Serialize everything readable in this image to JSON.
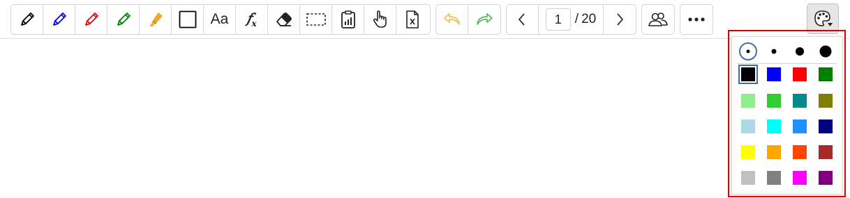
{
  "toolbar": {
    "tools": [
      {
        "name": "pencil-black",
        "icon": "pencil-icon",
        "color": "#000000"
      },
      {
        "name": "pencil-blue",
        "icon": "pencil-icon",
        "color": "#0000ee"
      },
      {
        "name": "pencil-red",
        "icon": "pencil-icon",
        "color": "#ee0000"
      },
      {
        "name": "pencil-green",
        "icon": "pencil-icon",
        "color": "#008000"
      },
      {
        "name": "highlighter",
        "icon": "highlighter-icon",
        "color": "#f5a623"
      },
      {
        "name": "rectangle",
        "icon": "rectangle-icon"
      },
      {
        "name": "text",
        "icon": "text-icon",
        "label": "Aa"
      },
      {
        "name": "formula",
        "icon": "formula-icon",
        "label": "fx"
      },
      {
        "name": "eraser",
        "icon": "eraser-icon"
      },
      {
        "name": "select",
        "icon": "dashed-select-icon"
      },
      {
        "name": "clipboard-chart",
        "icon": "clipboard-chart-icon"
      },
      {
        "name": "pointer",
        "icon": "hand-pointer-icon"
      },
      {
        "name": "clear-page",
        "icon": "clear-file-icon"
      }
    ],
    "history": {
      "undo_color": "#f0c050",
      "redo_color": "#5cb85c"
    },
    "pagination": {
      "current": "1",
      "separator": "/",
      "total": "20"
    }
  },
  "palette_panel": {
    "sizes": [
      {
        "name": "size-small",
        "selected": true
      },
      {
        "name": "size-medium",
        "selected": false
      },
      {
        "name": "size-large",
        "selected": false
      },
      {
        "name": "size-xlarge",
        "selected": false
      }
    ],
    "colors": [
      [
        "#000000",
        "#0000ff",
        "#ff0000",
        "#008000"
      ],
      [
        "#90ee90",
        "#32cd32",
        "#008b8b",
        "#808000"
      ],
      [
        "#add8e6",
        "#00ffff",
        "#1e90ff",
        "#000080"
      ],
      [
        "#ffff00",
        "#ffa500",
        "#ff4500",
        "#a52a2a"
      ],
      [
        "#c0c0c0",
        "#808080",
        "#ff00ff",
        "#800080"
      ]
    ],
    "selected_color": "#000000"
  }
}
